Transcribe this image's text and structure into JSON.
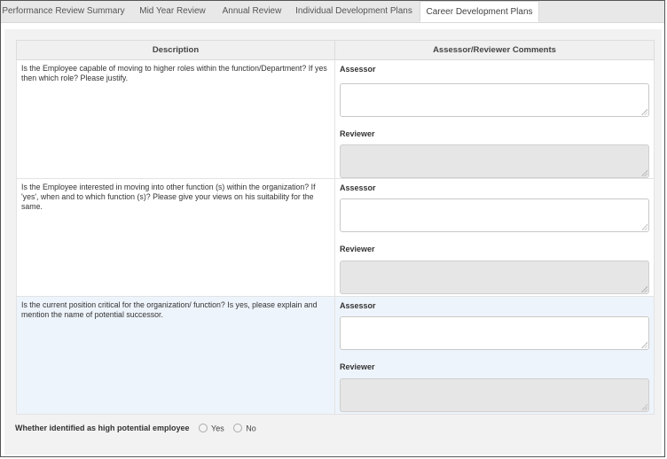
{
  "tabs": [
    {
      "label": "Performance Review Summary",
      "active": false
    },
    {
      "label": "Mid Year Review",
      "active": false
    },
    {
      "label": "Annual Review",
      "active": false
    },
    {
      "label": "Individual Development Plans",
      "active": false
    },
    {
      "label": "Career Development Plans",
      "active": true
    }
  ],
  "table": {
    "headers": {
      "description": "Description",
      "comments": "Assessor/Reviewer Comments"
    },
    "rows": [
      {
        "description": "Is the Employee capable of moving to higher roles within the function/Department? If yes then which role? Please justify.",
        "assessor_label": "Assessor",
        "assessor_value": "",
        "reviewer_label": "Reviewer",
        "reviewer_value": ""
      },
      {
        "description": "Is the Employee interested in moving into other function (s) within the organization? If 'yes', when and to which function (s)? Please give your views on his suitability for the same.",
        "assessor_label": "Assessor",
        "assessor_value": "",
        "reviewer_label": "Reviewer",
        "reviewer_value": ""
      },
      {
        "description": "Is the current position critical for the organization/ function? Is yes, please explain and mention the name of potential successor.",
        "assessor_label": "Assessor",
        "assessor_value": "",
        "reviewer_label": "Reviewer",
        "reviewer_value": ""
      }
    ]
  },
  "high_potential": {
    "label": "Whether identified as high potential employee",
    "options": [
      "Yes",
      "No"
    ]
  },
  "colors": {
    "highlight_row": "#eef4fb",
    "readonly_field": "#e6e6e6"
  }
}
